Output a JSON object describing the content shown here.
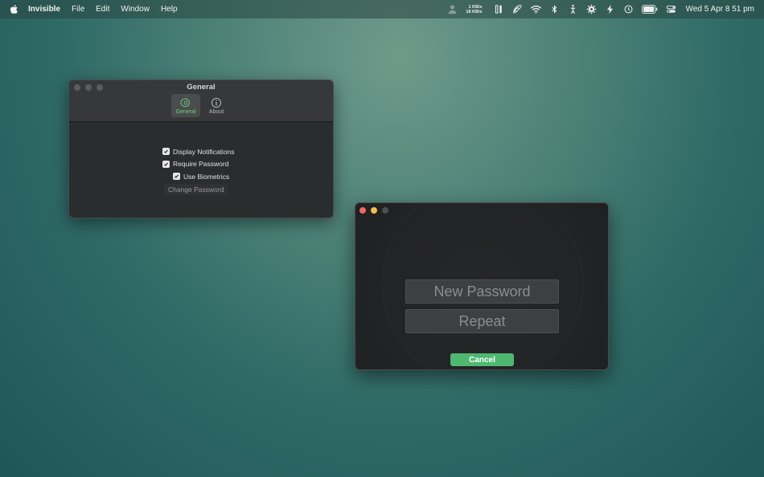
{
  "menubar": {
    "app_name": "Invisible",
    "items": [
      {
        "label": "File"
      },
      {
        "label": "Edit"
      },
      {
        "label": "Window"
      },
      {
        "label": "Help"
      }
    ],
    "netspeed_up": "1 KB/s",
    "netspeed_down": "18 KB/s",
    "clock": "Wed 5 Apr  8 51 pm"
  },
  "general_window": {
    "title": "General",
    "tabs": [
      {
        "label": "General",
        "icon": "gear-icon",
        "active": true
      },
      {
        "label": "About",
        "icon": "info-icon",
        "active": false
      }
    ],
    "options": {
      "display_notifications": "Display Notifications",
      "require_password": "Require Password",
      "use_biometrics": "Use Biometrics"
    },
    "change_password_label": "Change Password"
  },
  "password_window": {
    "new_password_placeholder": "New Password",
    "repeat_placeholder": "Repeat",
    "cancel_label": "Cancel"
  },
  "colors": {
    "accent_green": "#4fb870",
    "active_tab_green": "#6fcf7a",
    "close_red": "#ed6a5e",
    "minimize_yellow": "#f5bf4f"
  }
}
